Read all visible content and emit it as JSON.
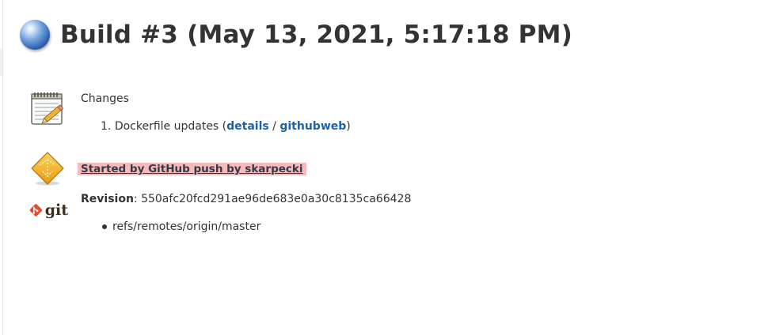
{
  "header": {
    "title": "Build #3 (May 13, 2021, 5:17:18 PM)",
    "status_icon": "blue-ball-icon",
    "status_color": "#2c62b3"
  },
  "changes": {
    "icon": "notepad-icon",
    "label": "Changes",
    "items": [
      {
        "number": "1.",
        "text": "Dockerfile updates (",
        "details_label": "details",
        "separator": " / ",
        "githubweb_label": "githubweb",
        "close": ")"
      }
    ]
  },
  "cause": {
    "icon": "github-push-icon",
    "text": "Started by GitHub push by skarpecki",
    "highlight_color": "#f6b9bc"
  },
  "git": {
    "icon": "git-logo-icon",
    "logo_text": "git",
    "revision_label": "Revision",
    "revision_value": ": 550afc20fcd291ae96de683e0a30c8135ca66428",
    "branches": [
      "refs/remotes/origin/master"
    ]
  },
  "colors": {
    "link": "#1e62a6",
    "text": "#333333"
  }
}
